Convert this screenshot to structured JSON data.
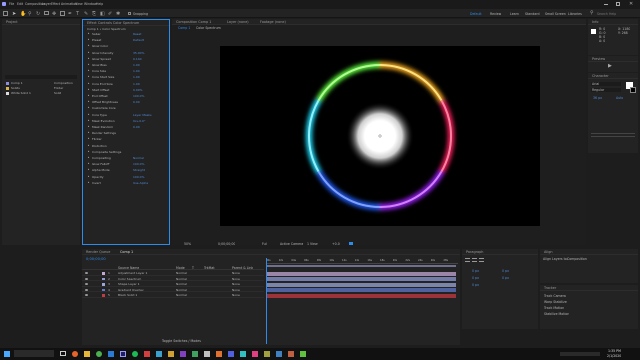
{
  "menu": {
    "items": [
      "File",
      "Edit",
      "Composition",
      "Layer",
      "Effect",
      "Animation",
      "View",
      "Window",
      "Help"
    ]
  },
  "toolbar": {
    "snapping_label": "Snapping",
    "workspaces": [
      "Default",
      "Review",
      "Learn",
      "Standard",
      "Small Screen",
      "Libraries"
    ],
    "search_placeholder": "Search Help"
  },
  "project_panel": {
    "title": "Project",
    "items": [
      {
        "name": "Comp 1",
        "type": "Composition"
      },
      {
        "name": "Solids",
        "type": "Folder"
      },
      {
        "name": "White Solid 1",
        "type": "Solid"
      }
    ]
  },
  "effect_controls": {
    "title": "Effect Controls  Color Spectrum",
    "layer": "Comp 1 • Color Spectrum",
    "rows": [
      {
        "name": "Saber",
        "value": "Reset",
        "kind": "group"
      },
      {
        "name": "Preset",
        "value": "Default"
      },
      {
        "name": "Glow Color",
        "value": ""
      },
      {
        "name": "Glow Intensity",
        "value": "35.00%"
      },
      {
        "name": "Glow Spread",
        "value": "0.140"
      },
      {
        "name": "Glow Bias",
        "value": "1.00"
      },
      {
        "name": "Core Size",
        "value": "1.04"
      },
      {
        "name": "Core Start Size",
        "value": "1.00"
      },
      {
        "name": "Core End Size",
        "value": "1.00"
      },
      {
        "name": "Start Offset",
        "value": "0.00%"
      },
      {
        "name": "End Offset",
        "value": "100.0%"
      },
      {
        "name": "Offset Brightness",
        "value": "0.00"
      },
      {
        "name": "Customize Core",
        "value": ""
      },
      {
        "name": "Core Type",
        "value": "Layer Masks"
      },
      {
        "name": "Mask Evolution",
        "value": "0x+0.0°"
      },
      {
        "name": "Mask Random",
        "value": "0.00"
      },
      {
        "name": "Render Settings",
        "value": ""
      },
      {
        "name": "Flicker",
        "value": ""
      },
      {
        "name": "Distortion",
        "value": ""
      },
      {
        "name": "Composite Settings",
        "value": ""
      },
      {
        "name": "Compositing",
        "value": "Normal"
      },
      {
        "name": "Glow Falloff",
        "value": "100.0%"
      },
      {
        "name": "Alpha Mode",
        "value": "Straight"
      },
      {
        "name": "Opacity",
        "value": "100.0%"
      },
      {
        "name": "Invert",
        "value": "Use Alpha"
      }
    ]
  },
  "composition_panel": {
    "title": "Composition  Comp 1",
    "tabs": [
      "Comp 1",
      "Color Spectrum"
    ],
    "layer_tab": "Layer  (none)",
    "footage_tab": "Footage  (none)",
    "zoom": "50%",
    "timecode": "0;00;00;00",
    "resolution": "Full",
    "camera": "Active Camera",
    "views": "1 View",
    "offset": "+0.0"
  },
  "timeline": {
    "comp_tab": "Comp 1",
    "render_queue_tab": "Render Queue",
    "timecode": "0;00;00;00",
    "columns": [
      "Source Name",
      "Mode",
      "T",
      "TrkMat",
      "Parent & Link"
    ],
    "layers": [
      {
        "num": "1",
        "name": "Adjustment Layer 1",
        "mode": "Normal",
        "parent": "None",
        "color": "#c4a8d6"
      },
      {
        "num": "2",
        "name": "Color Spectrum",
        "mode": "Normal",
        "parent": "None",
        "color": "#8f9bd6"
      },
      {
        "num": "3",
        "name": "Shape Layer 1",
        "mode": "Normal",
        "parent": "None",
        "color": "#9aa7d8"
      },
      {
        "num": "4",
        "name": "Gradient Overlay",
        "mode": "Normal",
        "parent": "None",
        "color": "#5f78c8"
      },
      {
        "num": "5",
        "name": "Black Solid 1",
        "mode": "Normal",
        "parent": "None",
        "color": "#c43a42"
      }
    ],
    "ruler": [
      "00s",
      "02s",
      "04s",
      "06s",
      "08s",
      "10s",
      "12s",
      "14s",
      "16s",
      "18s",
      "20s",
      "22s",
      "24s",
      "26s",
      "28s"
    ],
    "footer": "Toggle Switches / Modes"
  },
  "info_panel": {
    "title": "Info",
    "values": [
      "R: 0",
      "G: 0",
      "B: 0",
      "A: 0",
      "X: 1180",
      "Y: 268"
    ]
  },
  "character_panel": {
    "title": "Character",
    "font": "Arial",
    "style": "Regular",
    "size": "36 px",
    "leading": "Auto"
  },
  "paragraph_panel": {
    "title": "Paragraph",
    "labels": [
      "0 px",
      "0 px",
      "0 px",
      "0 px",
      "0 px"
    ]
  },
  "align_panel": {
    "title": "Align",
    "align_to": "Align Layers to:",
    "selection": "Composition"
  },
  "tracker_panel": {
    "title": "Tracker",
    "rows": [
      "Track Camera",
      "Warp Stabilize",
      "Track Motion",
      "Stabilize Motion"
    ]
  },
  "preview_panel": {
    "title": "Preview"
  },
  "taskbar": {
    "time": "1:35 PM",
    "date": "2/1/2020"
  },
  "colors": {
    "accent": "#2d8ceb",
    "panel_bg": "#232323",
    "app_bg": "#1d1d1d"
  }
}
